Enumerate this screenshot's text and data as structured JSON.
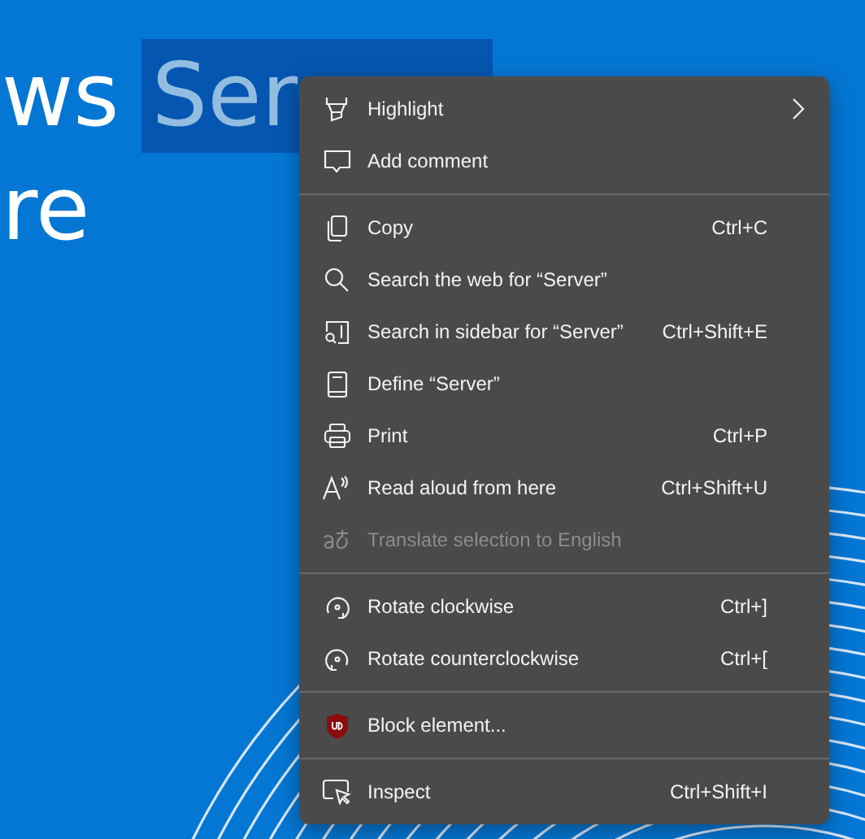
{
  "page": {
    "heading_line_1": "ws",
    "heading_selected": "Ser",
    "heading_line_2": "re"
  },
  "context_menu": {
    "groups": [
      {
        "items": [
          {
            "label": "Highlight",
            "submenu": true,
            "disabled": false
          },
          {
            "label": "Add comment",
            "submenu": false,
            "disabled": false
          }
        ]
      },
      {
        "items": [
          {
            "label": "Copy",
            "shortcut": "Ctrl+C",
            "submenu": false,
            "disabled": false
          },
          {
            "label": "Search the web for “Server”",
            "submenu": false,
            "disabled": false
          },
          {
            "label": "Search in sidebar for “Server”",
            "shortcut": "Ctrl+Shift+E",
            "submenu": false,
            "disabled": false
          },
          {
            "label": "Define “Server”",
            "submenu": false,
            "disabled": false
          },
          {
            "label": "Print",
            "shortcut": "Ctrl+P",
            "submenu": false,
            "disabled": false
          },
          {
            "label": "Read aloud from here",
            "shortcut": "Ctrl+Shift+U",
            "submenu": false,
            "disabled": false
          },
          {
            "label": "Translate selection to English",
            "submenu": false,
            "disabled": true
          }
        ]
      },
      {
        "items": [
          {
            "label": "Rotate clockwise",
            "shortcut": "Ctrl+]",
            "submenu": false,
            "disabled": false
          },
          {
            "label": "Rotate counterclockwise",
            "shortcut": "Ctrl+[",
            "submenu": false,
            "disabled": false
          }
        ]
      },
      {
        "items": [
          {
            "label": "Block element...",
            "submenu": false,
            "disabled": false
          }
        ]
      },
      {
        "items": [
          {
            "label": "Inspect",
            "shortcut": "Ctrl+Shift+I",
            "submenu": false,
            "disabled": false
          }
        ]
      }
    ]
  }
}
